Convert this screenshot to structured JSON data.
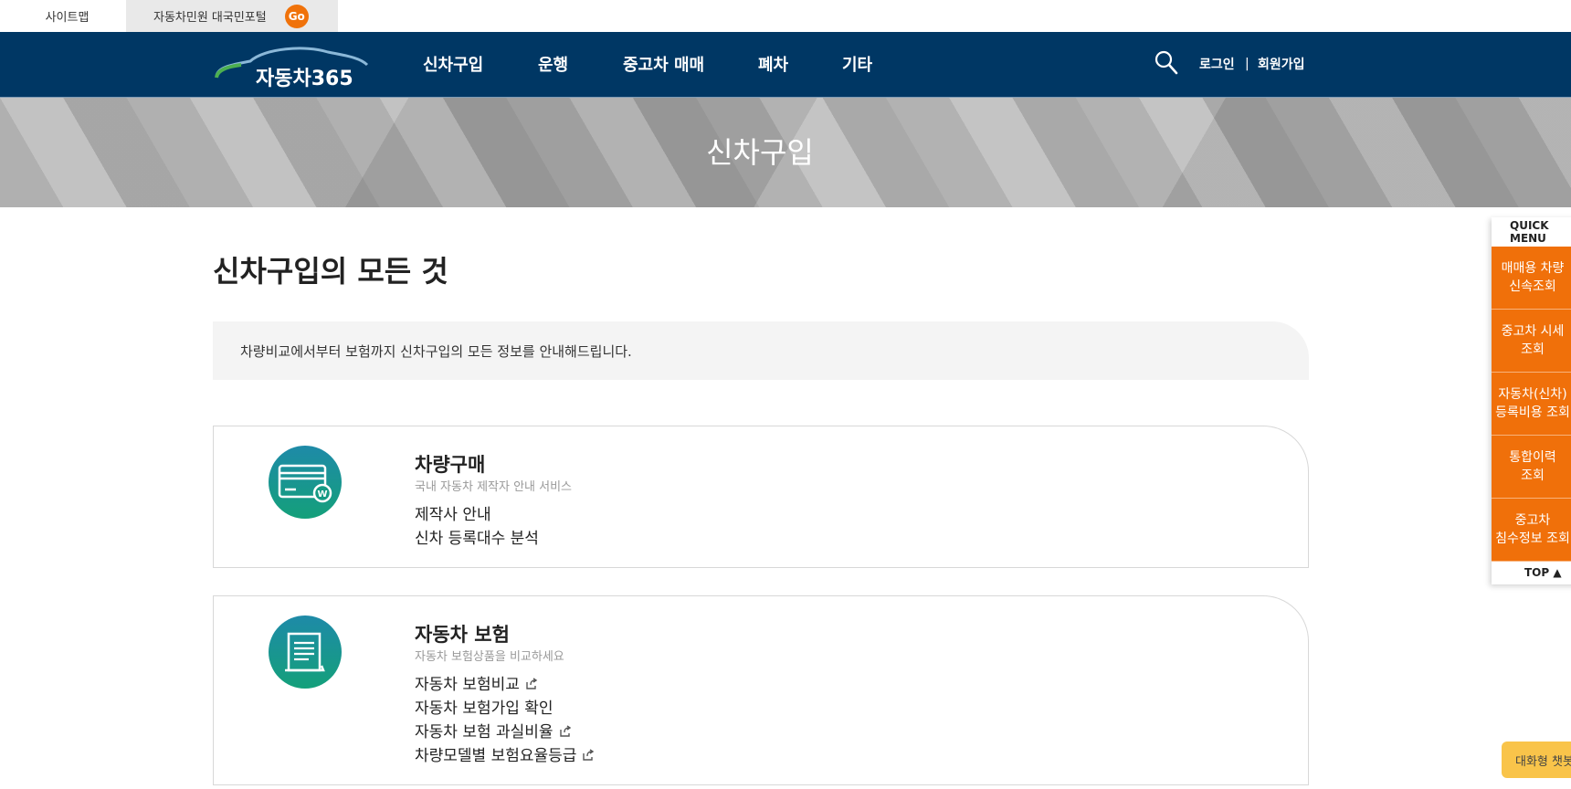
{
  "util": {
    "sitemap": "사이트맵",
    "portal": "자동차민원 대국민포털",
    "go": "Go"
  },
  "nav": {
    "logo": "자동차365",
    "menu": [
      "신차구입",
      "운행",
      "중고차 매매",
      "폐차",
      "기타"
    ],
    "login": "로그인",
    "separator": "|",
    "signup": "회원가입"
  },
  "banner": {
    "title": "신차구입"
  },
  "main": {
    "title": "신차구입의 모든 것",
    "intro": "차량비교에서부터 보험까지 신차구입의 모든 정보를 안내해드립니다."
  },
  "cards": [
    {
      "icon": "credit-card-won-icon",
      "title": "차량구매",
      "subtitle": "국내 자동차 제작자 안내 서비스",
      "links": [
        {
          "label": "제작사 안내",
          "external": false
        },
        {
          "label": "신차 등록대수 분석",
          "external": false
        }
      ]
    },
    {
      "icon": "document-icon",
      "title": "자동차 보험",
      "subtitle": "자동차 보험상품을 비교하세요",
      "links": [
        {
          "label": "자동차 보험비교",
          "external": true
        },
        {
          "label": "자동차 보험가입 확인",
          "external": false
        },
        {
          "label": "자동차 보험 과실비율",
          "external": true
        },
        {
          "label": "차량모델별 보험요율등급",
          "external": true
        }
      ]
    }
  ],
  "quick": {
    "header": "QUICK MENU",
    "items": [
      [
        "매매용 차량",
        "신속조회"
      ],
      [
        "중고차 시세",
        "조회"
      ],
      [
        "자동차(신차)",
        "등록비용 조회"
      ],
      [
        "통합이력",
        "조회"
      ],
      [
        "중고차",
        "침수정보 조회"
      ]
    ],
    "top": "TOP ▲"
  },
  "chatbot": "대화형 챗봇",
  "colors": {
    "nav": "#003764",
    "accent": "#f0720a",
    "icon_gradient_start": "#1e8aa8",
    "icon_gradient_end": "#14a07a",
    "chatbot": "#f9c44a"
  }
}
